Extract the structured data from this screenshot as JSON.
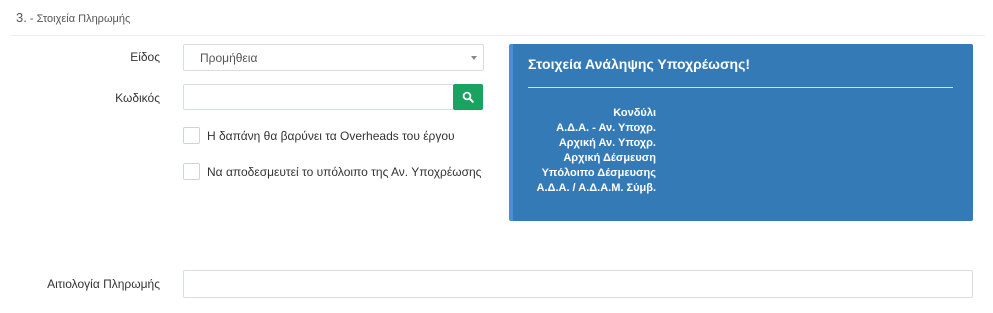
{
  "section": {
    "number": "3.",
    "title": "- Στοιχεία Πληρωμής"
  },
  "form": {
    "type_label": "Είδος",
    "type_value": "Προμήθεια",
    "code_label": "Κωδικός",
    "code_value": "",
    "checkbox_overheads": "Η δαπάνη θα βαρύνει τα Overheads του έργου",
    "checkbox_release": "Να αποδεσμευτεί το υπόλοιπο της Αν. Υποχρέωσης",
    "reason_label": "Αιτιολογία Πληρωμής",
    "reason_value": ""
  },
  "panel": {
    "title": "Στοιχεία Ανάληψης Υποχρέωσης!",
    "items": [
      "Κονδύλι",
      "Α.Δ.Α. - Αν. Υποχρ.",
      "Αρχική Αν. Υποχρ.",
      "Αρχική Δέσμευση",
      "Υπόλοιπο Δέσμευσης",
      "Α.Δ.Α. / Α.Δ.Α.Μ. Σύμβ."
    ]
  },
  "colors": {
    "panel_bg": "#337ab7",
    "search_button": "#1aa260"
  },
  "icons": {
    "search_button_icon": "search-icon",
    "select_caret": "caret-down-icon"
  }
}
